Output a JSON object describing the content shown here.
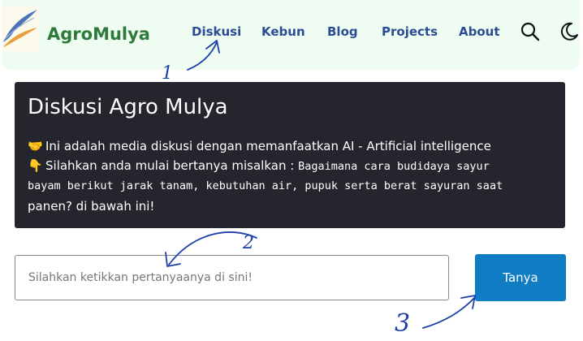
{
  "nav": {
    "brand": "AgroMulya",
    "links": [
      "Diskusi",
      "Kebun",
      "Blog",
      "Projects",
      "About"
    ]
  },
  "hero": {
    "title": "Diskusi Agro Mulya",
    "line1": "Ini adalah media diskusi dengan memanfaatkan AI - Artificial intelligence",
    "line2_lead": "Silahkan anda mulai bertanya misalkan :",
    "line2_example": "Bagaimana cara budidaya sayur",
    "line3": "bayam berikut jarak tanam, kebutuhan air, pupuk serta berat sayuran saat",
    "line4": "panen? di bawah ini!",
    "emoji1": "🤝",
    "emoji2": "👇"
  },
  "form": {
    "placeholder": "Silahkan ketikkan pertanyaanya di sini!",
    "value": "",
    "button_label": "Tanya"
  },
  "annotations": {
    "a1": "1",
    "a2": "2",
    "a3": "3"
  },
  "colors": {
    "nav_bg": "#effcf2",
    "brand": "#2f7a3a",
    "nav_link": "#2b4b94",
    "hero_bg": "#25252d",
    "button": "#0f7cc4",
    "annotation_ink": "#1d3fa8"
  },
  "icons": [
    "logo-feather-icon",
    "search-icon",
    "moon-icon"
  ]
}
